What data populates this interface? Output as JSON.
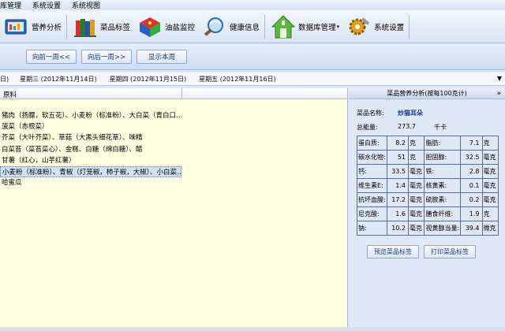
{
  "menu": [
    "库管理",
    "系统设置",
    "系统视图"
  ],
  "toolbar": [
    {
      "label": "营养分析",
      "icon": "nutrition-icon"
    },
    {
      "label": "菜品标签",
      "icon": "books-icon"
    },
    {
      "label": "油盐监控",
      "icon": "cube-icon"
    },
    {
      "label": "健康信息",
      "icon": "magnifier-icon"
    },
    {
      "label": "数据库管理",
      "icon": "house-icon"
    },
    {
      "label": "系统设置",
      "icon": "gear-icon"
    }
  ],
  "weeknav": {
    "prev": "向前一周<<",
    "next": "向后一周>>",
    "current": "显示本周"
  },
  "days": [
    "日)",
    "星期三 (2012年11月14日)",
    "星期四 (2012年11月15日)",
    "星期五 (2012年11月16日)"
  ],
  "left": {
    "header": "原料",
    "items": [
      "猪肉（扬膘，软五花）、小麦粉（标准粉）、大白菜（青白口…",
      "菠菜（赤根菜）",
      "芥菜（大叶芥菜）、草菇（大黑头细花草）、味精",
      "白菜苔（菜苔菜心）、金糕、白糖（绵白糖）、醋",
      "甘薯（红心，山芋红薯）",
      "小麦粉（标准粉）、青椒（灯笼椒，柿子椒，大椒）、小白菜…",
      "哈蜜瓜"
    ],
    "selected_index": 5
  },
  "right": {
    "title": "菜品营养分析(按每100克计)",
    "dish_label": "菜品名称:",
    "dish_name": "炒猫耳朵",
    "energy_label": "总能量:",
    "energy_value": "273.7",
    "energy_unit": "千卡",
    "rows": [
      [
        "蛋白质:",
        "8.2",
        "克",
        "脂肪:",
        "7.1",
        "克"
      ],
      [
        "碳水化物:",
        "51",
        "克",
        "胆固醇:",
        "32.5",
        "毫克"
      ],
      [
        "钙:",
        "33.5",
        "毫克",
        "铁:",
        "2.8",
        "毫克"
      ],
      [
        "维生素E:",
        "1.4",
        "毫克",
        "核黄素:",
        "0.1",
        "毫克"
      ],
      [
        "抗坏血酸:",
        "17.2",
        "毫克",
        "硫胺素:",
        "0.2",
        "毫克"
      ],
      [
        "尼克酸:",
        "1.6",
        "毫克",
        "膳食纤维:",
        "1.9",
        "克"
      ],
      [
        "钠:",
        "10.2",
        "毫克",
        "视黄醇当量:",
        "39.4",
        "微克"
      ]
    ],
    "preview_button": "预览菜品标签",
    "print_button": "打印菜品标签"
  }
}
